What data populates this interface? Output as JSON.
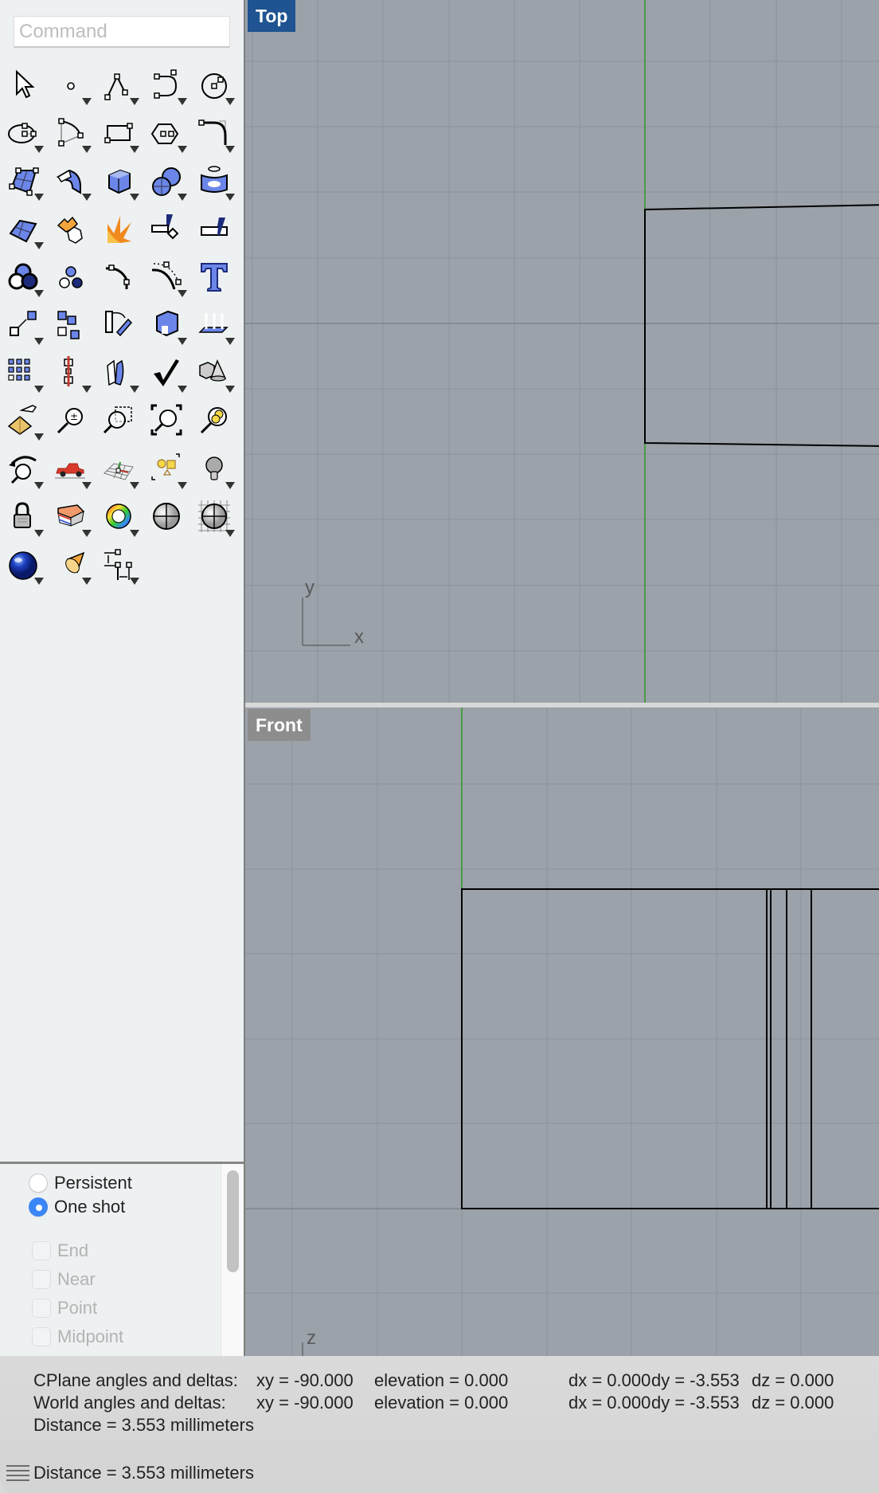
{
  "command": {
    "placeholder": "Command",
    "value": ""
  },
  "toolbar": {
    "rows": [
      [
        {
          "name": "select-arrow-icon",
          "flyout": false
        },
        {
          "name": "point-icon",
          "flyout": true
        },
        {
          "name": "polyline-icon",
          "flyout": true
        },
        {
          "name": "curve-icon",
          "flyout": true
        },
        {
          "name": "circle-icon",
          "flyout": true
        }
      ],
      [
        {
          "name": "ellipse-icon",
          "flyout": true
        },
        {
          "name": "arc-icon",
          "flyout": true
        },
        {
          "name": "rectangle-icon",
          "flyout": true
        },
        {
          "name": "polygon-icon",
          "flyout": true
        },
        {
          "name": "fillet-curve-icon",
          "flyout": true
        }
      ],
      [
        {
          "name": "surface-corner-points-icon",
          "flyout": true
        },
        {
          "name": "extrude-surface-icon",
          "flyout": true
        },
        {
          "name": "box-icon",
          "flyout": true
        },
        {
          "name": "spheres-icon",
          "flyout": true
        },
        {
          "name": "mesh-icon",
          "flyout": true
        }
      ],
      [
        {
          "name": "surface-tools-icon",
          "flyout": true
        },
        {
          "name": "join-puzzle-icon",
          "flyout": false
        },
        {
          "name": "explode-icon",
          "flyout": false
        },
        {
          "name": "trim-icon",
          "flyout": false
        },
        {
          "name": "split-icon",
          "flyout": false
        }
      ],
      [
        {
          "name": "boolean-union-icon",
          "flyout": true
        },
        {
          "name": "group-icon",
          "flyout": false
        },
        {
          "name": "fillet-edge-icon",
          "flyout": false
        },
        {
          "name": "offset-curve-icon",
          "flyout": true
        },
        {
          "name": "text-icon",
          "flyout": false
        }
      ],
      [
        {
          "name": "move-icon",
          "flyout": true
        },
        {
          "name": "copy-icon",
          "flyout": false
        },
        {
          "name": "rotate-icon",
          "flyout": false
        },
        {
          "name": "solid-tools-icon",
          "flyout": true
        },
        {
          "name": "project-icon",
          "flyout": true
        }
      ],
      [
        {
          "name": "array-icon",
          "flyout": true
        },
        {
          "name": "mirror-icon",
          "flyout": true
        },
        {
          "name": "bend-icon",
          "flyout": true
        },
        {
          "name": "check-icon",
          "flyout": true
        },
        {
          "name": "solid-primitives-icon",
          "flyout": true
        }
      ],
      [
        {
          "name": "pan-pyramid-icon",
          "flyout": true
        },
        {
          "name": "zoom-in-out-icon",
          "flyout": false
        },
        {
          "name": "zoom-window-icon",
          "flyout": false
        },
        {
          "name": "zoom-extents-icon",
          "flyout": false
        },
        {
          "name": "zoom-selected-icon",
          "flyout": false
        }
      ],
      [
        {
          "name": "undo-view-icon",
          "flyout": true
        },
        {
          "name": "car-icon",
          "flyout": true
        },
        {
          "name": "cplane-grid-icon",
          "flyout": true
        },
        {
          "name": "shapes-icon",
          "flyout": true
        },
        {
          "name": "light-bulb-icon",
          "flyout": true
        }
      ],
      [
        {
          "name": "lock-icon",
          "flyout": true
        },
        {
          "name": "layers-icon",
          "flyout": true
        },
        {
          "name": "color-wheel-icon",
          "flyout": true
        },
        {
          "name": "shaded-sphere-icon",
          "flyout": false
        },
        {
          "name": "grid-sphere-icon",
          "flyout": true
        }
      ],
      [
        {
          "name": "render-sphere-icon",
          "flyout": true
        },
        {
          "name": "camera-cone-icon",
          "flyout": true
        },
        {
          "name": "dimension-icon",
          "flyout": true
        }
      ]
    ]
  },
  "osnap": {
    "mode_options": [
      {
        "label": "Persistent",
        "selected": false
      },
      {
        "label": "One shot",
        "selected": true
      }
    ],
    "snaps": [
      {
        "label": "End",
        "checked": false,
        "enabled": false
      },
      {
        "label": "Near",
        "checked": false,
        "enabled": false
      },
      {
        "label": "Point",
        "checked": false,
        "enabled": false
      },
      {
        "label": "Midpoint",
        "checked": false,
        "enabled": false
      }
    ]
  },
  "viewports": {
    "top": {
      "label": "Top",
      "axis_x": "x",
      "axis_y": "y",
      "label_color": "#1f5391"
    },
    "front": {
      "label": "Front",
      "axis_z": "z",
      "label_color": "#8d8d8d"
    }
  },
  "colors": {
    "viewport_bg": "#9ba2aa",
    "grid_line": "#8e959d",
    "grid_major": "#7d848c",
    "y_axis": "#4a9a46",
    "geometry": "#000000",
    "accent": "#3b86f7"
  },
  "status": {
    "cplane_label": "CPlane angles and deltas:",
    "cplane_xy": "xy = -90.000",
    "cplane_elevation": "elevation = 0.000",
    "cplane_dx": "dx = 0.000",
    "cplane_dy": "dy = -3.553",
    "cplane_dz": "dz = 0.000",
    "world_label": "World angles and deltas:",
    "world_xy": "xy = -90.000",
    "world_elevation": "elevation = 0.000",
    "world_dx": "dx = 0.000",
    "world_dy": "dy = -3.553",
    "world_dz": "dz = 0.000",
    "distance": "Distance = 3.553 millimeters",
    "prompt": "Distance = 3.553 millimeters"
  }
}
